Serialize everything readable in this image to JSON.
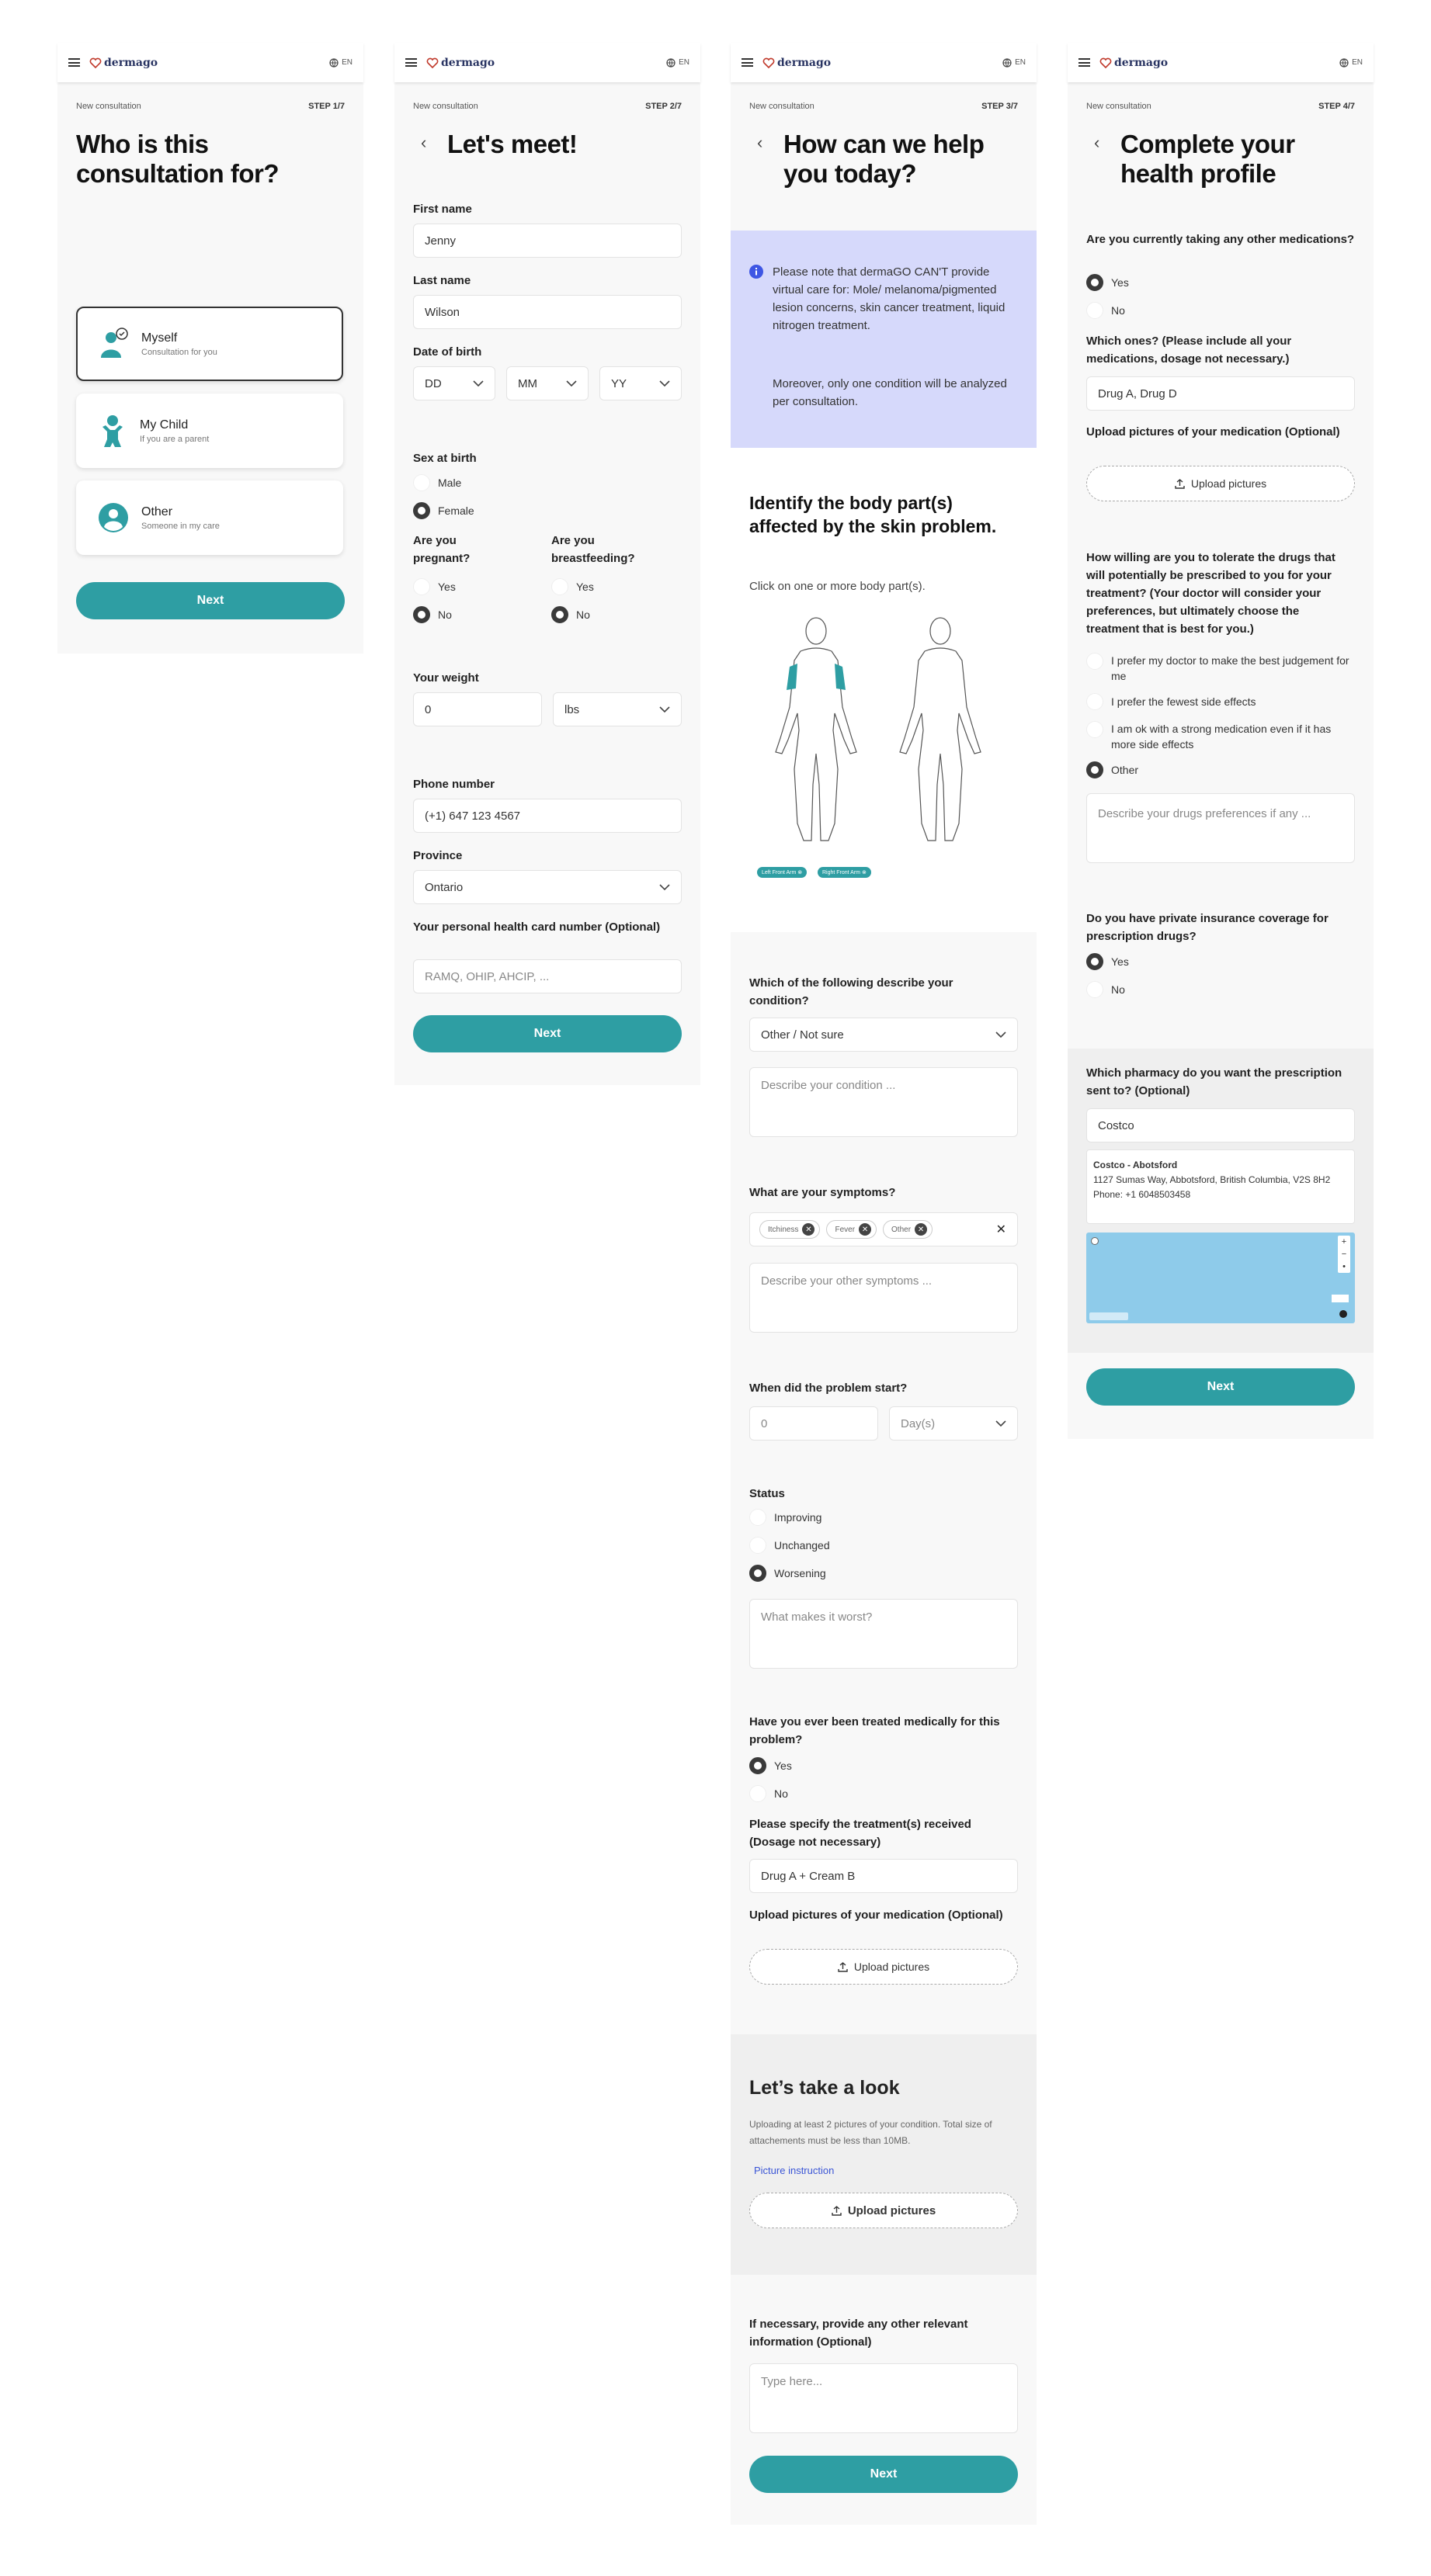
{
  "app": {
    "brand": "dermago",
    "lang": "EN",
    "new_consultation": "New consultation",
    "next": "Next"
  },
  "colors": {
    "accent": "#2e9ea3",
    "info_bg": "#d6d9fb",
    "info_icon": "#3e56e4",
    "link": "#3a55d6"
  },
  "s1": {
    "step": "STEP 1/7",
    "title": "Who is this consultation for?",
    "options": [
      {
        "name": "Myself",
        "sub": "Consultation for you",
        "selected": true,
        "icon": "person-check-icon"
      },
      {
        "name": "My Child",
        "sub": "If you are a parent",
        "selected": false,
        "icon": "child-icon"
      },
      {
        "name": "Other",
        "sub": "Someone in my care",
        "selected": false,
        "icon": "person-circle-icon"
      }
    ]
  },
  "s2": {
    "step": "STEP 2/7",
    "title": "Let's meet!",
    "first_name_label": "First name",
    "first_name": "Jenny",
    "last_name_label": "Last name",
    "last_name": "Wilson",
    "dob_label": "Date of birth",
    "dd": "DD",
    "mm": "MM",
    "yy": "YY",
    "sex_label": "Sex at birth",
    "male": "Male",
    "female": "Female",
    "sex_selected": "Female",
    "pregnant_label": "Are you pregnant?",
    "breastfeeding_label": "Are you breastfeeding?",
    "yes": "Yes",
    "no": "No",
    "pregnant": "No",
    "breastfeeding": "No",
    "weight_label": "Your weight",
    "weight": "0",
    "weight_unit": "lbs",
    "phone_label": "Phone number",
    "phone": "(+1) 647 123 4567",
    "province_label": "Province",
    "province": "Ontario",
    "card_label": "Your personal health card number (Optional)",
    "card_placeholder": "RAMQ, OHIP, AHCIP, ..."
  },
  "s3": {
    "step": "STEP 3/7",
    "title": "How can we help you today?",
    "notice_1": "Please note that dermaGO CAN'T provide virtual care for: Mole/ melanoma/pigmented lesion concerns, skin cancer treatment, liquid nitrogen treatment.",
    "notice_2": "Moreover, only one condition will be analyzed per consultation.",
    "body_title": "Identify the body part(s) affected by the skin problem.",
    "body_sub": "Click on one or more body part(s).",
    "tags": [
      "Left Front Arm",
      "Right Front Arm"
    ],
    "condition_label": "Which of the following describe your condition?",
    "condition": "Other / Not sure",
    "condition_placeholder": "Describe your condition ...",
    "symptoms_label": "What are your symptoms?",
    "symptoms": [
      "Itchiness",
      "Fever",
      "Other"
    ],
    "symptoms_placeholder": "Describe your other symptoms ...",
    "start_label": "When did the problem start?",
    "start_value": "0",
    "start_unit": "Day(s)",
    "status_label": "Status",
    "status_options": [
      "Improving",
      "Unchanged",
      "Worsening"
    ],
    "status_selected": "Worsening",
    "worst_placeholder": "What makes it worst?",
    "treated_label": "Have you ever been treated medically for this problem?",
    "yes": "Yes",
    "no": "No",
    "treated": "Yes",
    "treatment_label": "Please specify the treatment(s) received (Dosage not necessary)",
    "treatment": "Drug A + Cream B",
    "med_pics_label": "Upload pictures of your medication (Optional)",
    "upload": "Upload pictures",
    "look_title": "Let’s take a look",
    "look_text": "Uploading at least 2 pictures of your condition. Total size of attachements must be less than 10MB.",
    "instruction": "Picture instruction",
    "other_info_label": "If necessary, provide any other relevant information (Optional)",
    "other_info_placeholder": "Type here..."
  },
  "s4": {
    "step": "STEP 4/7",
    "title": "Complete your health profile",
    "other_meds_label": "Are you currently taking any other medications?",
    "yes": "Yes",
    "no": "No",
    "other_meds": "Yes",
    "which_label": "Which ones? (Please include all your medications, dosage not necessary.)",
    "which": "Drug A, Drug D",
    "pics_label": "Upload pictures of your medication (Optional)",
    "upload": "Upload pictures",
    "tolerate_label": "How willing are you to tolerate the drugs that will potentially be prescribed to you for your treatment? (Your doctor will consider your preferences, but ultimately choose the treatment that is best for you.)",
    "tolerate_options": [
      "I prefer my doctor to make the best judgement for me",
      "I prefer the fewest side effects",
      "I am ok with a strong medication even if it has more side effects",
      "Other"
    ],
    "tolerate_selected": "Other",
    "pref_placeholder": "Describe your drugs preferences if any ...",
    "insurance_label": "Do you have private insurance coverage for prescription drugs?",
    "insurance": "Yes",
    "pharmacy_label": "Which pharmacy do you want the prescription sent to? (Optional)",
    "pharmacy": "Costco",
    "pharmacy_name": "Costco - Abotsford",
    "pharmacy_address": "1127 Sumas Way, Abbotsford, British Columbia, V2S 8H2",
    "pharmacy_phone": "Phone: +1 6048503458"
  }
}
